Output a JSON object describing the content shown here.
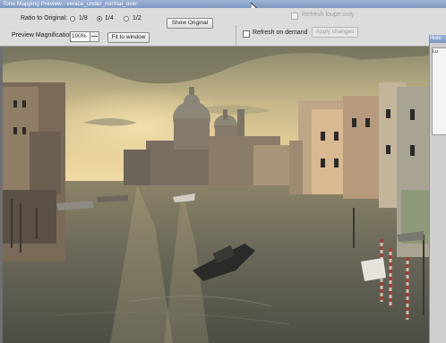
{
  "window": {
    "title": "Tone Mapping Preview - venice_under_normal_over"
  },
  "toolbar": {
    "ratio_label": "Ratio to Original:",
    "ratio_options": [
      {
        "label": "1/8",
        "selected": false
      },
      {
        "label": "1/4",
        "selected": true
      },
      {
        "label": "1/2",
        "selected": false
      }
    ],
    "show_original_label": "Show Original",
    "magnification_label": "Preview Magnification:",
    "magnification_value": "100%",
    "fit_to_window_label": "Fit to window",
    "refresh_loupe_label": "Refresh loupe only",
    "refresh_on_demand_label": "Refresh on demand",
    "apply_changes_label": "Apply changes"
  },
  "side_panel": {
    "header": "Histo",
    "content_label": "Lu"
  },
  "preview": {
    "description_icon": "venice-canal-photo"
  },
  "colors": {
    "titlebar": "#8aa3cc",
    "toolbar_bg": "#dcdcdc",
    "window_bg": "#6f6f6f"
  }
}
